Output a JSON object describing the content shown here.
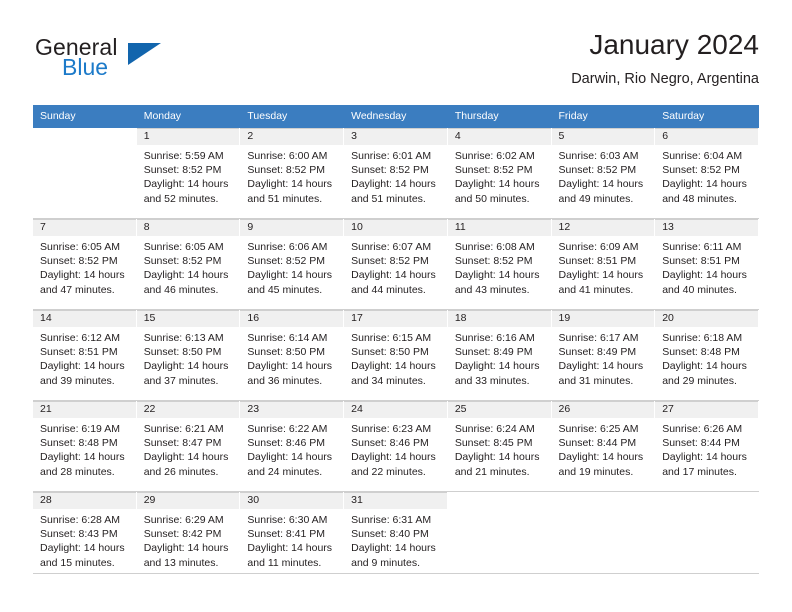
{
  "brand": {
    "name_part1": "General",
    "name_part2": "Blue",
    "triangle_color": "#1265ad",
    "blue_color": "#1c7ac9"
  },
  "header": {
    "title": "January 2024",
    "subtitle": "Darwin, Rio Negro, Argentina"
  },
  "calendar": {
    "header_bg": "#3b7dc0",
    "daynum_bg": "#f0f0f0",
    "weekdays": [
      "Sunday",
      "Monday",
      "Tuesday",
      "Wednesday",
      "Thursday",
      "Friday",
      "Saturday"
    ],
    "weeks": [
      [
        {
          "day": "",
          "sunrise": "",
          "sunset": "",
          "daylight1": "",
          "daylight2": ""
        },
        {
          "day": "1",
          "sunrise": "Sunrise: 5:59 AM",
          "sunset": "Sunset: 8:52 PM",
          "daylight1": "Daylight: 14 hours",
          "daylight2": "and 52 minutes."
        },
        {
          "day": "2",
          "sunrise": "Sunrise: 6:00 AM",
          "sunset": "Sunset: 8:52 PM",
          "daylight1": "Daylight: 14 hours",
          "daylight2": "and 51 minutes."
        },
        {
          "day": "3",
          "sunrise": "Sunrise: 6:01 AM",
          "sunset": "Sunset: 8:52 PM",
          "daylight1": "Daylight: 14 hours",
          "daylight2": "and 51 minutes."
        },
        {
          "day": "4",
          "sunrise": "Sunrise: 6:02 AM",
          "sunset": "Sunset: 8:52 PM",
          "daylight1": "Daylight: 14 hours",
          "daylight2": "and 50 minutes."
        },
        {
          "day": "5",
          "sunrise": "Sunrise: 6:03 AM",
          "sunset": "Sunset: 8:52 PM",
          "daylight1": "Daylight: 14 hours",
          "daylight2": "and 49 minutes."
        },
        {
          "day": "6",
          "sunrise": "Sunrise: 6:04 AM",
          "sunset": "Sunset: 8:52 PM",
          "daylight1": "Daylight: 14 hours",
          "daylight2": "and 48 minutes."
        }
      ],
      [
        {
          "day": "7",
          "sunrise": "Sunrise: 6:05 AM",
          "sunset": "Sunset: 8:52 PM",
          "daylight1": "Daylight: 14 hours",
          "daylight2": "and 47 minutes."
        },
        {
          "day": "8",
          "sunrise": "Sunrise: 6:05 AM",
          "sunset": "Sunset: 8:52 PM",
          "daylight1": "Daylight: 14 hours",
          "daylight2": "and 46 minutes."
        },
        {
          "day": "9",
          "sunrise": "Sunrise: 6:06 AM",
          "sunset": "Sunset: 8:52 PM",
          "daylight1": "Daylight: 14 hours",
          "daylight2": "and 45 minutes."
        },
        {
          "day": "10",
          "sunrise": "Sunrise: 6:07 AM",
          "sunset": "Sunset: 8:52 PM",
          "daylight1": "Daylight: 14 hours",
          "daylight2": "and 44 minutes."
        },
        {
          "day": "11",
          "sunrise": "Sunrise: 6:08 AM",
          "sunset": "Sunset: 8:52 PM",
          "daylight1": "Daylight: 14 hours",
          "daylight2": "and 43 minutes."
        },
        {
          "day": "12",
          "sunrise": "Sunrise: 6:09 AM",
          "sunset": "Sunset: 8:51 PM",
          "daylight1": "Daylight: 14 hours",
          "daylight2": "and 41 minutes."
        },
        {
          "day": "13",
          "sunrise": "Sunrise: 6:11 AM",
          "sunset": "Sunset: 8:51 PM",
          "daylight1": "Daylight: 14 hours",
          "daylight2": "and 40 minutes."
        }
      ],
      [
        {
          "day": "14",
          "sunrise": "Sunrise: 6:12 AM",
          "sunset": "Sunset: 8:51 PM",
          "daylight1": "Daylight: 14 hours",
          "daylight2": "and 39 minutes."
        },
        {
          "day": "15",
          "sunrise": "Sunrise: 6:13 AM",
          "sunset": "Sunset: 8:50 PM",
          "daylight1": "Daylight: 14 hours",
          "daylight2": "and 37 minutes."
        },
        {
          "day": "16",
          "sunrise": "Sunrise: 6:14 AM",
          "sunset": "Sunset: 8:50 PM",
          "daylight1": "Daylight: 14 hours",
          "daylight2": "and 36 minutes."
        },
        {
          "day": "17",
          "sunrise": "Sunrise: 6:15 AM",
          "sunset": "Sunset: 8:50 PM",
          "daylight1": "Daylight: 14 hours",
          "daylight2": "and 34 minutes."
        },
        {
          "day": "18",
          "sunrise": "Sunrise: 6:16 AM",
          "sunset": "Sunset: 8:49 PM",
          "daylight1": "Daylight: 14 hours",
          "daylight2": "and 33 minutes."
        },
        {
          "day": "19",
          "sunrise": "Sunrise: 6:17 AM",
          "sunset": "Sunset: 8:49 PM",
          "daylight1": "Daylight: 14 hours",
          "daylight2": "and 31 minutes."
        },
        {
          "day": "20",
          "sunrise": "Sunrise: 6:18 AM",
          "sunset": "Sunset: 8:48 PM",
          "daylight1": "Daylight: 14 hours",
          "daylight2": "and 29 minutes."
        }
      ],
      [
        {
          "day": "21",
          "sunrise": "Sunrise: 6:19 AM",
          "sunset": "Sunset: 8:48 PM",
          "daylight1": "Daylight: 14 hours",
          "daylight2": "and 28 minutes."
        },
        {
          "day": "22",
          "sunrise": "Sunrise: 6:21 AM",
          "sunset": "Sunset: 8:47 PM",
          "daylight1": "Daylight: 14 hours",
          "daylight2": "and 26 minutes."
        },
        {
          "day": "23",
          "sunrise": "Sunrise: 6:22 AM",
          "sunset": "Sunset: 8:46 PM",
          "daylight1": "Daylight: 14 hours",
          "daylight2": "and 24 minutes."
        },
        {
          "day": "24",
          "sunrise": "Sunrise: 6:23 AM",
          "sunset": "Sunset: 8:46 PM",
          "daylight1": "Daylight: 14 hours",
          "daylight2": "and 22 minutes."
        },
        {
          "day": "25",
          "sunrise": "Sunrise: 6:24 AM",
          "sunset": "Sunset: 8:45 PM",
          "daylight1": "Daylight: 14 hours",
          "daylight2": "and 21 minutes."
        },
        {
          "day": "26",
          "sunrise": "Sunrise: 6:25 AM",
          "sunset": "Sunset: 8:44 PM",
          "daylight1": "Daylight: 14 hours",
          "daylight2": "and 19 minutes."
        },
        {
          "day": "27",
          "sunrise": "Sunrise: 6:26 AM",
          "sunset": "Sunset: 8:44 PM",
          "daylight1": "Daylight: 14 hours",
          "daylight2": "and 17 minutes."
        }
      ],
      [
        {
          "day": "28",
          "sunrise": "Sunrise: 6:28 AM",
          "sunset": "Sunset: 8:43 PM",
          "daylight1": "Daylight: 14 hours",
          "daylight2": "and 15 minutes."
        },
        {
          "day": "29",
          "sunrise": "Sunrise: 6:29 AM",
          "sunset": "Sunset: 8:42 PM",
          "daylight1": "Daylight: 14 hours",
          "daylight2": "and 13 minutes."
        },
        {
          "day": "30",
          "sunrise": "Sunrise: 6:30 AM",
          "sunset": "Sunset: 8:41 PM",
          "daylight1": "Daylight: 14 hours",
          "daylight2": "and 11 minutes."
        },
        {
          "day": "31",
          "sunrise": "Sunrise: 6:31 AM",
          "sunset": "Sunset: 8:40 PM",
          "daylight1": "Daylight: 14 hours",
          "daylight2": "and 9 minutes."
        },
        {
          "day": "",
          "sunrise": "",
          "sunset": "",
          "daylight1": "",
          "daylight2": ""
        },
        {
          "day": "",
          "sunrise": "",
          "sunset": "",
          "daylight1": "",
          "daylight2": ""
        },
        {
          "day": "",
          "sunrise": "",
          "sunset": "",
          "daylight1": "",
          "daylight2": ""
        }
      ]
    ]
  }
}
